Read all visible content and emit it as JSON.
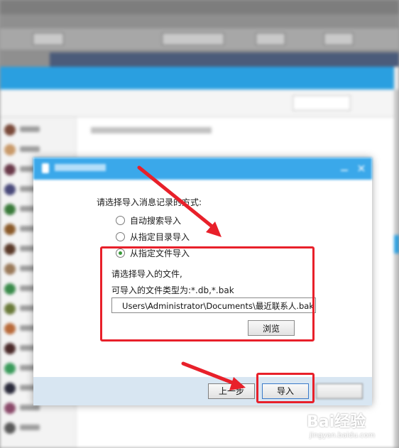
{
  "dialog": {
    "prompt": "请选择导入消息记录的方式:",
    "options": [
      {
        "label": "自动搜索导入",
        "selected": false
      },
      {
        "label": "从指定目录导入",
        "selected": false
      },
      {
        "label": "从指定文件导入",
        "selected": true
      }
    ],
    "file_select_label": "请选择导入的文件,",
    "file_types_label": "可导入的文件类型为:*.db,*.bak",
    "file_path": "Users\\Administrator\\Documents\\最近联系人.bak",
    "browse_label": "浏览",
    "prev_label": "上一步",
    "import_label": "导入"
  },
  "watermark": {
    "logo": "Bai经验",
    "url": "jingyan.baidu.com"
  },
  "colors": {
    "accent": "#3aa8ea",
    "highlight": "#e8202a",
    "footer": "#d8e6f2"
  }
}
